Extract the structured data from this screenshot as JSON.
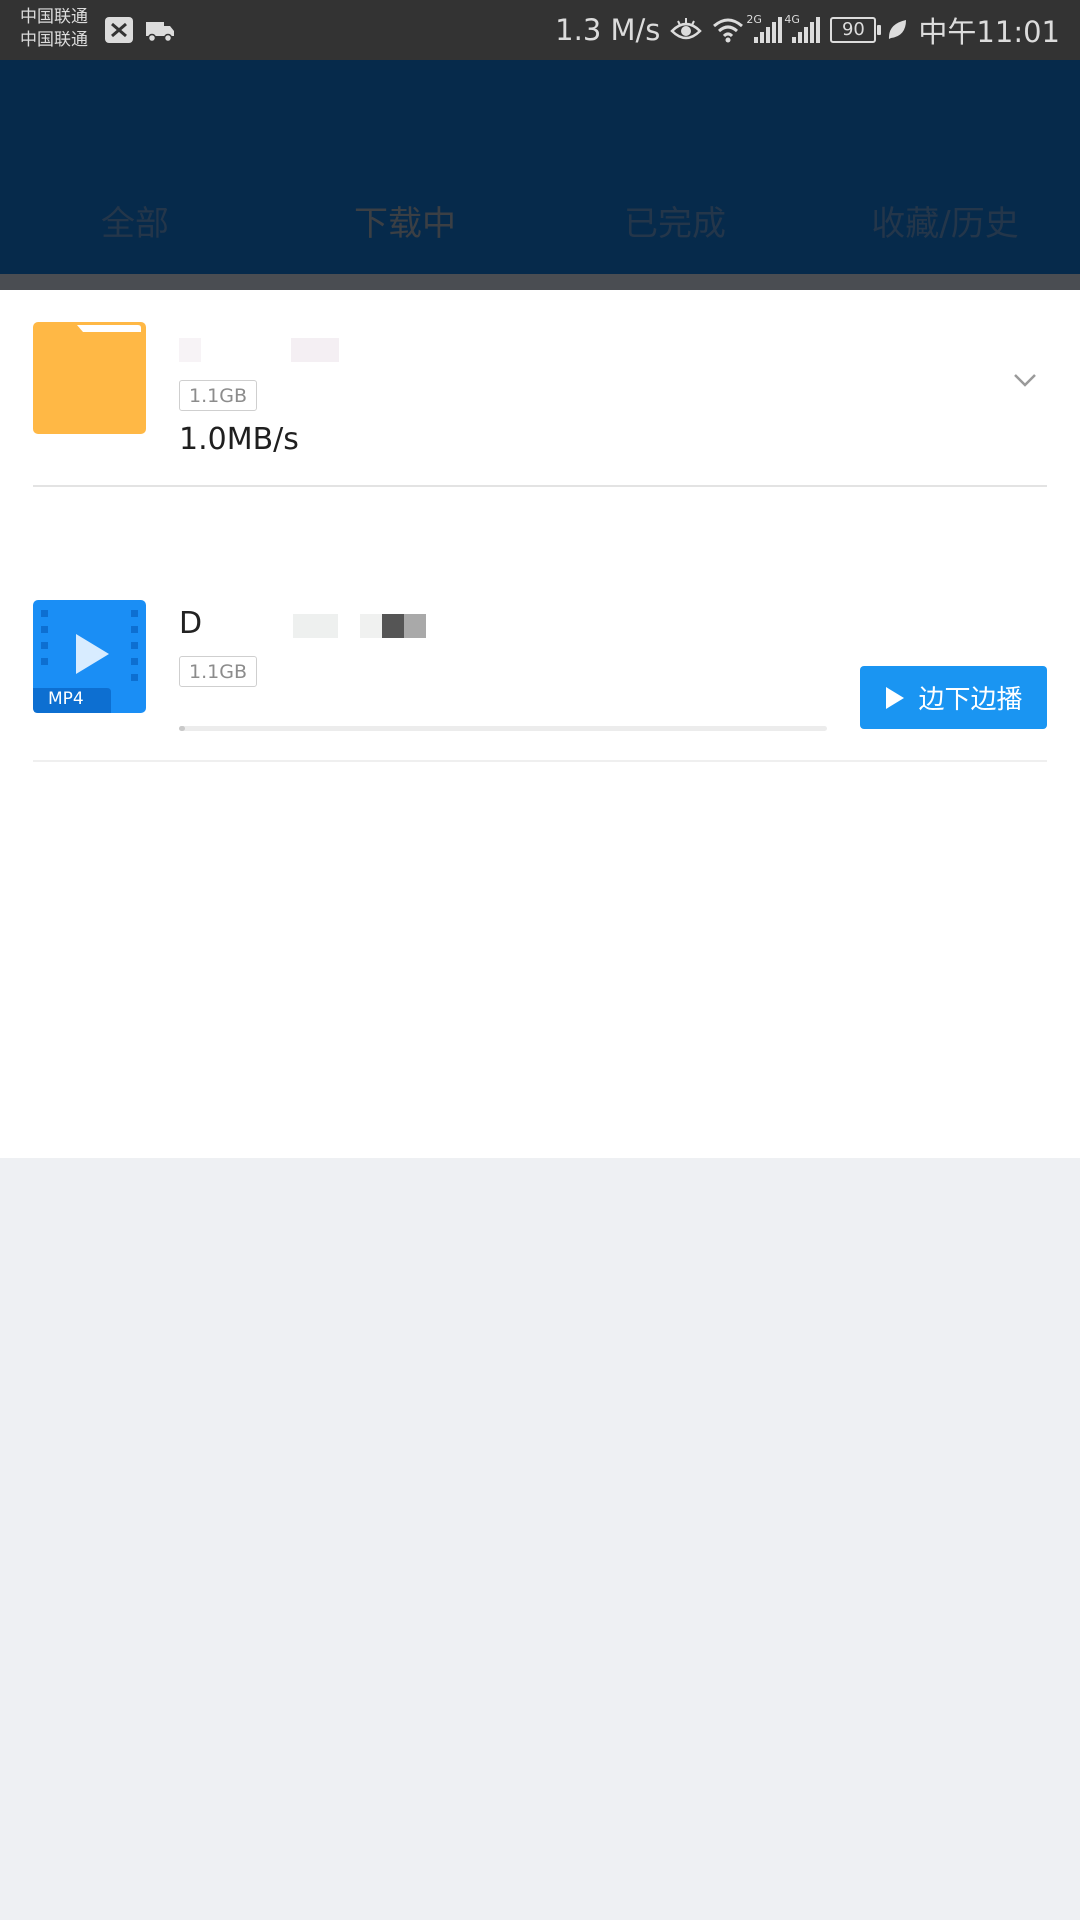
{
  "status_bar": {
    "carrier_1": "中国联通",
    "carrier_2": "中国联通",
    "net_speed": "1.3 M/s",
    "sig1_label": "2G",
    "sig2_label": "4G",
    "battery": "90",
    "time": "中午11:01"
  },
  "tabs": [
    {
      "label": "全部",
      "active": false
    },
    {
      "label": "下载中",
      "active": true
    },
    {
      "label": "已完成",
      "active": false
    },
    {
      "label": "收藏/历史",
      "active": false
    }
  ],
  "downloads": [
    {
      "icon": "folder-icon",
      "size": "1.1GB",
      "speed": "1.0MB/s"
    },
    {
      "icon": "mp4-video-icon",
      "name_prefix": "D",
      "format": "MP4",
      "size": "1.1GB",
      "progress": 0.01,
      "action_label": "边下边播"
    }
  ],
  "colors": {
    "header_bg": "#062a4b",
    "accent_blue": "#1a95f2",
    "folder_yellow": "#ffb845"
  }
}
